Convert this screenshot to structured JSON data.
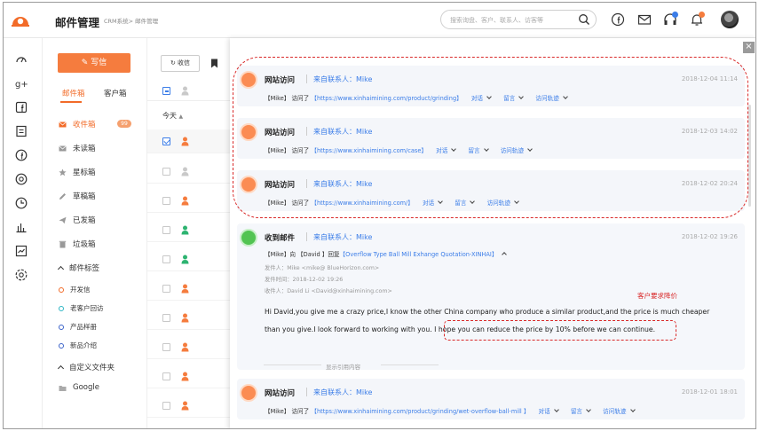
{
  "header": {
    "title": "邮件管理",
    "breadcrumb": "CRM系统> 邮件管理",
    "search_placeholder": "搜索询盘、客户、联系人、访客等"
  },
  "colors": {
    "accent": "#f26b28",
    "button": "#f57c3e",
    "link": "#3b7de8",
    "annotation": "#d92a2a"
  },
  "sidebar": {
    "write_label": "写信",
    "tabs": [
      "邮件箱",
      "客户箱"
    ],
    "folders": [
      {
        "label": "收件箱",
        "icon": "inbox-icon",
        "badge": "99"
      },
      {
        "label": "未读箱",
        "icon": "unread-icon"
      },
      {
        "label": "星标箱",
        "icon": "star-icon"
      },
      {
        "label": "草稿箱",
        "icon": "draft-icon"
      },
      {
        "label": "已发箱",
        "icon": "sent-icon"
      },
      {
        "label": "垃圾箱",
        "icon": "trash-icon"
      }
    ],
    "tags_label": "邮件标签",
    "tags": [
      "开发信",
      "老客户回访",
      "产品样册",
      "新品介绍"
    ],
    "custom_label": "自定义文件夹",
    "custom_folders": [
      "Google"
    ]
  },
  "list": {
    "receive_label": "收信",
    "group_label": "今天"
  },
  "drawer": {
    "close_label": "×",
    "visit_title": "网站访问",
    "from_prefix": "来自联系人：",
    "visit_verb": "访问了",
    "actions": [
      "对话",
      "留言",
      "访问轨迹"
    ],
    "cards": [
      {
        "name": "Mike",
        "time": "2018-12-04 11:14",
        "visitor": "【Mike】",
        "url": "【https://www.xinhaimining.com/product/grinding】"
      },
      {
        "name": "Mike",
        "time": "2018-12-03 14:02",
        "visitor": "【Mike】",
        "url": "【https://www.xinhaimining.com/case】"
      },
      {
        "name": "Mike",
        "time": "2018-12-02 20:24",
        "visitor": "【Mike】",
        "url": "【https://www.xinhaimining.com/】"
      }
    ],
    "mail": {
      "title": "收到邮件",
      "name": "Mike",
      "time": "2018-12-02 19:26",
      "line_prefix": "【Mike】向 【David 】回复",
      "subject": "【Overflow Type Ball Mill Exhange Quotation-XINHAI】",
      "from_line": "发件人：Mike <mike@ BlueHorizon.com>",
      "date_line": "发件时间：2018-12-02 19:26",
      "to_line": "收件人：David Li <David@xinhaimining.com>",
      "body_1": "Hi David,you give me a crazy price,I know the other China company who produce a similar product,and the price is much cheaper",
      "body_2a": "than you give.I look forward to working with you.",
      "body_2b": "I hope you can reduce the price by 10% before we can continue.",
      "annotation": "客户要求降价",
      "show_quote": "显示引用内容"
    },
    "last_card": {
      "name": "Mike",
      "time": "2018-12-01 18:01",
      "visitor": "【Mike】",
      "url": "【https://www.xinhaimining.com/product/grinding/wet-overflow-ball-mill 】"
    }
  }
}
